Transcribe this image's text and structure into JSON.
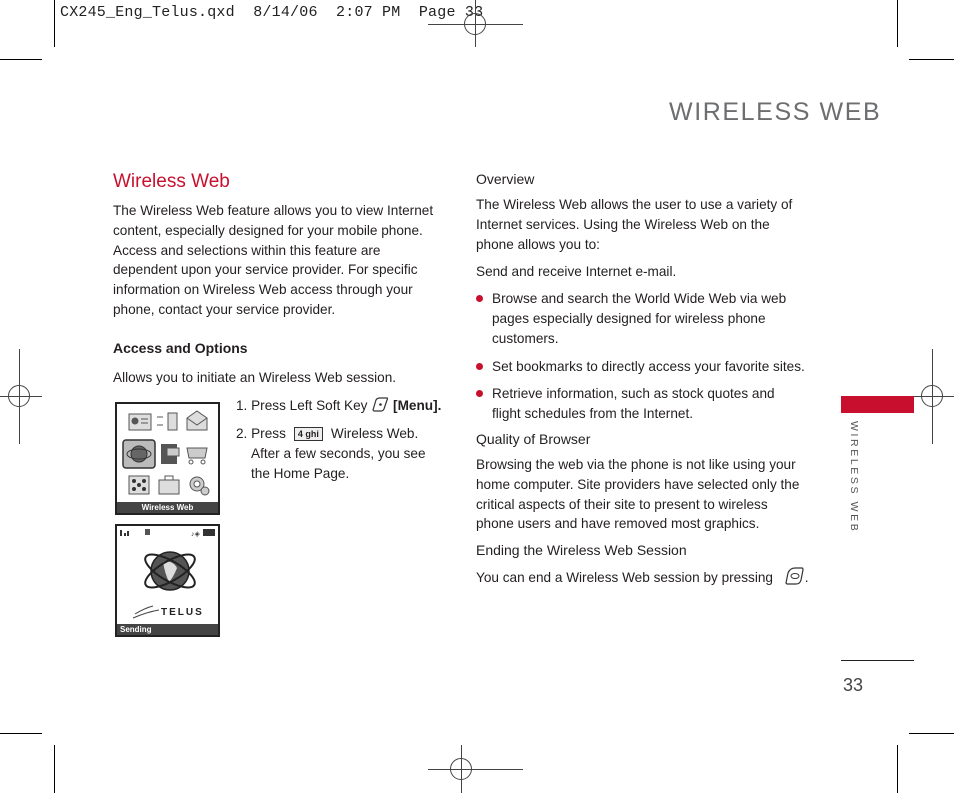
{
  "slug": "CX245_Eng_Telus.qxd  8/14/06  2:07 PM  Page 33",
  "header": {
    "title": "WIRELESS WEB"
  },
  "side_tab": {
    "label": "WIRELESS WEB",
    "color": "#c8102e"
  },
  "page_number": "33",
  "left": {
    "title": "Wireless Web",
    "intro": "The Wireless Web feature allows you to view Internet content,  especially designed for your mobile phone. Access and selections within this feature are dependent upon your service provider. For specific information on Wireless Web access through your phone, contact your service provider.",
    "access_heading": "Access and Options",
    "access_text": "Allows you to initiate an Wireless Web session.",
    "steps": [
      {
        "prefix": "1. Press Left Soft Key",
        "icon": "left-soft-key-icon",
        "suffix": "[Menu]."
      },
      {
        "prefix": "2. Press",
        "key_label": "4 ghi",
        "suffix": "Wireless Web.",
        "continuation": "After a few seconds, you see the Home Page."
      }
    ],
    "screen1": {
      "caption": "Wireless Web"
    },
    "screen2": {
      "brand": "TELUS",
      "soft_left": "Sending"
    }
  },
  "right": {
    "overview_heading": "Overview",
    "overview_text": "The Wireless Web allows the user to use a variety of Internet services. Using the Wireless Web on the phone allows you to:",
    "send_text": "Send and receive Internet e-mail.",
    "bullets": [
      "Browse and search the World Wide Web via web pages especially designed for wireless phone customers.",
      "Set bookmarks to directly access your favorite sites.",
      "Retrieve information, such as stock quotes and flight schedules from the Internet."
    ],
    "quality_heading": "Quality of Browser",
    "quality_text": "Browsing the web via the phone is not like using your home computer. Site providers have selected only the critical aspects of their site to present to wireless phone users and have removed most graphics.",
    "ending_heading": "Ending the Wireless Web Session",
    "ending_text": "You can end a Wireless Web session by pressing",
    "ending_icon": "end-key-icon"
  },
  "colors": {
    "accent": "#c8102e",
    "header_gray": "#6d6e70"
  }
}
